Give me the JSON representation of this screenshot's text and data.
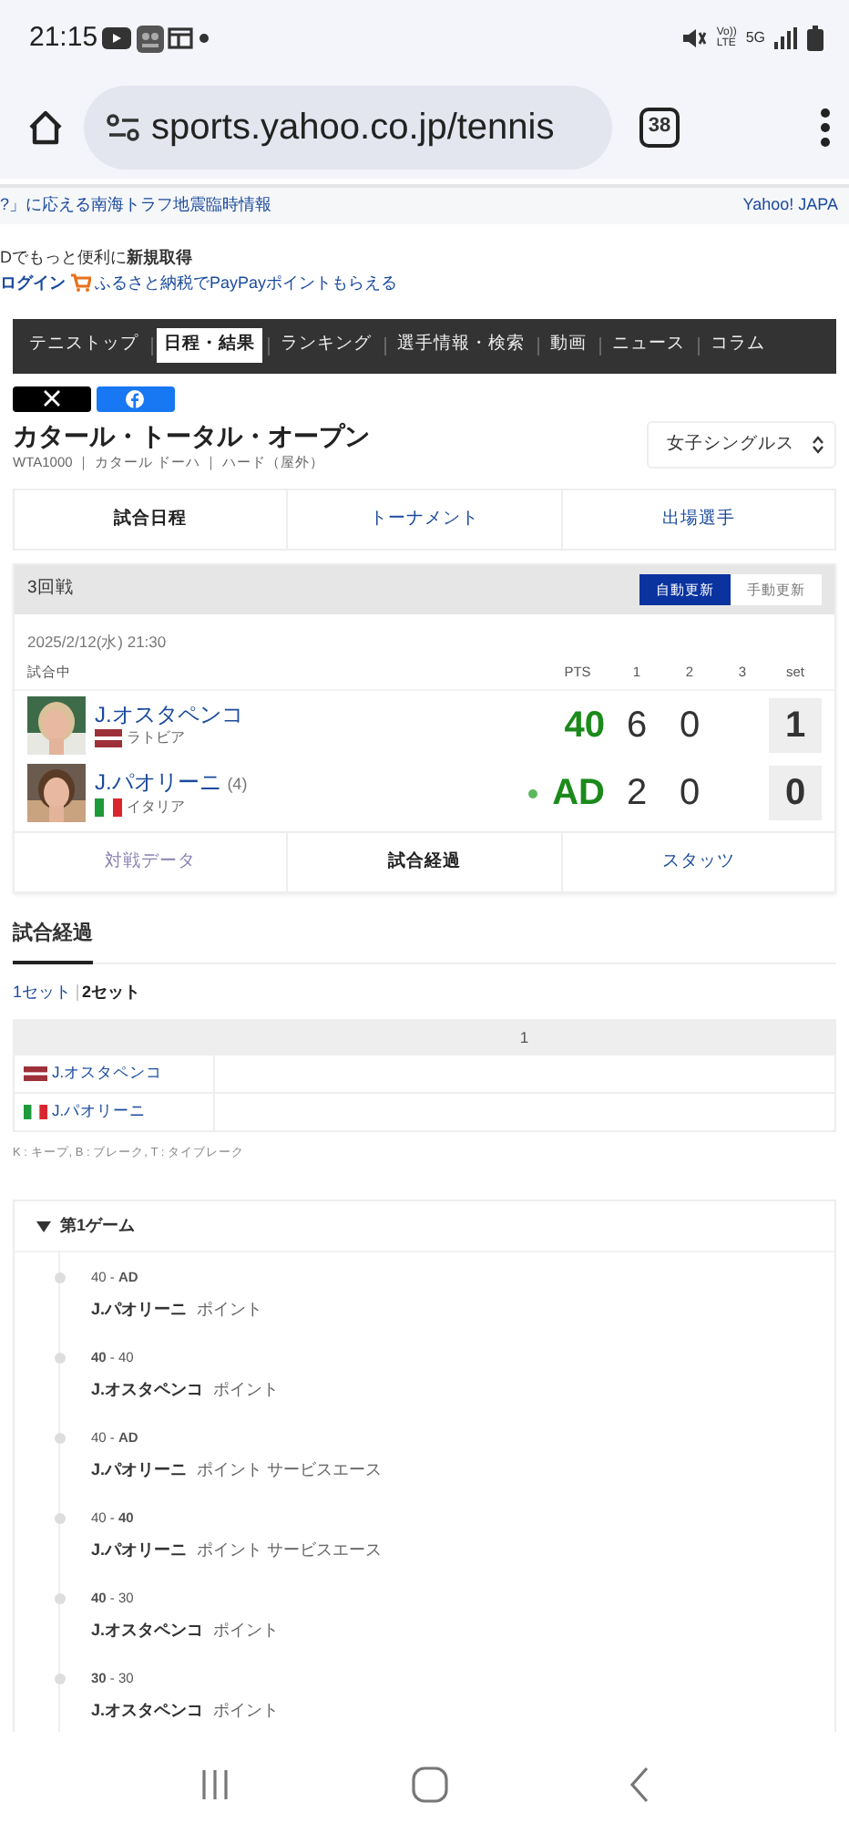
{
  "status_bar": {
    "time": "21:15",
    "volte": "Vo))",
    "volte_sub": "LTE",
    "network": "5G"
  },
  "browser": {
    "url": "sports.yahoo.co.jp/tennis",
    "tab_count": "38"
  },
  "alert_bar": {
    "text": "?」に応える南海トラフ地震臨時情報",
    "brand": "Yahoo! JAPA"
  },
  "login": {
    "notice": "Dでもっと便利に**新規取得**",
    "login_link": "ログイン",
    "promo": "ふるさと納税でPayPayポイントもらえる"
  },
  "nav_tabs": [
    {
      "label": "テニストップ",
      "selected": false
    },
    {
      "label": "日程・結果",
      "selected": true
    },
    {
      "label": "ランキング",
      "selected": false
    },
    {
      "label": "選手情報・検索",
      "selected": false
    },
    {
      "label": "動画",
      "selected": false
    },
    {
      "label": "ニュース",
      "selected": false
    },
    {
      "label": "コラム",
      "selected": false
    }
  ],
  "tournament": {
    "title": "カタール・トータル・オープン",
    "meta": "WTA1000 ｜ カタール ドーハ ｜ ハード（屋外）",
    "category": "女子シングルス"
  },
  "sub_tabs": [
    {
      "label": "試合日程",
      "selected": true
    },
    {
      "label": "トーナメント",
      "selected": false
    },
    {
      "label": "出場選手",
      "selected": false
    }
  ],
  "match": {
    "round": "3回戦",
    "update_modes": [
      {
        "label": "自動更新",
        "selected": true
      },
      {
        "label": "手動更新",
        "selected": false
      }
    ],
    "date": "2025/2/12(水) 21:30",
    "status": "試合中",
    "columns": [
      "PTS",
      "1",
      "2",
      "3",
      "set"
    ],
    "players": [
      {
        "name": "J.オスタペンコ",
        "country": "ラトビア",
        "kind": "latvia",
        "serving": false,
        "points": "40",
        "games": [
          "6",
          "0"
        ],
        "sets": "1"
      },
      {
        "name": "J.パオリーニ",
        "seed": "(4)",
        "country": "イタリア",
        "kind": "italy",
        "serving": true,
        "points": "AD",
        "games": [
          "2",
          "0"
        ],
        "sets": "0"
      }
    ],
    "tabs": [
      {
        "label": "対戦データ",
        "selected": false
      },
      {
        "label": "試合経過",
        "selected": true
      },
      {
        "label": "スタッツ",
        "selected": false
      }
    ]
  },
  "progress": {
    "title": "試合経過",
    "set_tabs": [
      {
        "label": "1セット",
        "selected": false
      },
      {
        "label": "2セット",
        "selected": true
      }
    ],
    "table": {
      "columns": [
        "1"
      ],
      "rows": [
        {
          "player": "J.オスタペンコ",
          "kind": "latvia"
        },
        {
          "player": "J.パオリーニ",
          "kind": "italy"
        }
      ]
    },
    "legend": "K : キープ, B : ブレーク, T : タイブレーク",
    "game": {
      "title": "第1ゲーム",
      "expanded": true,
      "points": [
        {
          "score": "40 - **AD**",
          "player": "J.パオリーニ",
          "detail": "ポイント"
        },
        {
          "score": "**40** - 40",
          "player": "J.オスタペンコ",
          "detail": "ポイント"
        },
        {
          "score": "40 - **AD**",
          "player": "J.パオリーニ",
          "detail": "ポイント サービスエース"
        },
        {
          "score": "40 - **40**",
          "player": "J.パオリーニ",
          "detail": "ポイント サービスエース"
        },
        {
          "score": "**40** - 30",
          "player": "J.オスタペンコ",
          "detail": "ポイント"
        },
        {
          "score": "**30** - 30",
          "player": "J.オスタペンコ",
          "detail": "ポイント"
        }
      ]
    }
  }
}
